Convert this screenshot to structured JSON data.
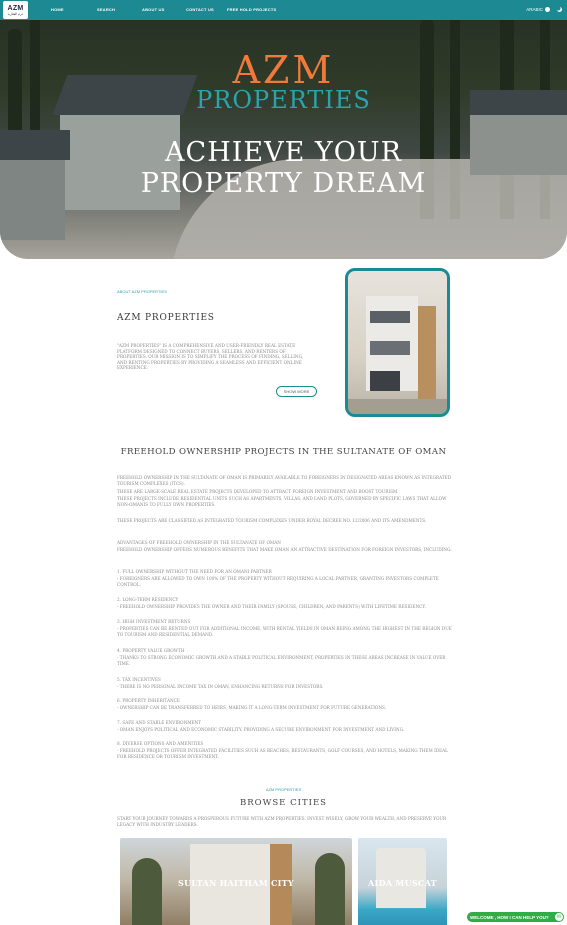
{
  "nav": {
    "logo_main": "AZM",
    "logo_sub": "عزم العقارية",
    "items": [
      "HOME",
      "SEARCH",
      "ABOUT US",
      "CONTACT US",
      "FREE HOLD PROJECTS"
    ],
    "language": "ARABIC",
    "icons": [
      "theme-dot-icon",
      "dark-mode-icon"
    ]
  },
  "hero": {
    "brand_line1": "AZM",
    "brand_line2": "PROPERTIES",
    "title_line1": "ACHIEVE YOUR",
    "title_line2": "PROPERTY DREAM"
  },
  "about": {
    "label": "ABOUT AZM PROPERTIES",
    "heading": "AZM  PROPERTIES",
    "text": "\"AZM PROPERTIES\" IS A COMPREHENSIVE AND USER-FRIENDLY REAL ESTATE PLATFORM DESIGNED TO CONNECT BUYERS, SELLERS, AND RENTERS OF PROPERTIES. OUR MISSION IS TO SIMPLIFY THE PROCESS OF FINDING, SELLING, AND RENTING PROPERTIES BY PROVIDING A SEAMLESS AND EFFICIENT ONLINE EXPERIENCE.",
    "button": "SHOW MORE"
  },
  "freehold": {
    "title": "FREEHOLD OWNERSHIP PROJECTS IN THE SULTANATE OF OMAN",
    "lines": [
      "FREEHOLD OWNERSHIP IN THE SULTANATE OF OMAN IS PRIMARILY AVAILABLE TO FOREIGNERS IN DESIGNATED AREAS KNOWN AS INTEGRATED TOURISM COMPLEXES (ITCS).",
      "THESE ARE LARGE-SCALE REAL ESTATE PROJECTS DEVELOPED TO ATTRACT FOREIGN INVESTMENT AND BOOST TOURISM.",
      "THESE PROJECTS INCLUDE RESIDENTIAL UNITS SUCH AS APARTMENTS, VILLAS, AND LAND PLOTS, GOVERNED BY SPECIFIC LAWS THAT ALLOW NON-OMANIS TO FULLY OWN PROPERTIES.",
      "THESE PROJECTS ARE CLASSIFIED AS INTEGRATED TOURISM COMPLEXES UNDER ROYAL DECREE NO. 12/2006 AND ITS AMENDMENTS.",
      "ADVANTAGES OF FREEHOLD OWNERSHIP IN THE SULTANATE OF OMAN",
      "FREEHOLD OWNERSHIP OFFERS NUMEROUS BENEFITS THAT MAKE OMAN AN ATTRACTIVE DESTINATION FOR FOREIGN INVESTORS, INCLUDING:",
      "1. FULL OWNERSHIP WITHOUT THE NEED FOR AN OMANI PARTNER",
      "- FOREIGNERS ARE ALLOWED TO OWN 100% OF THE PROPERTY WITHOUT REQUIRING A LOCAL PARTNER, GRANTING INVESTORS COMPLETE CONTROL.",
      "2. LONG-TERM RESIDENCY",
      "- FREEHOLD OWNERSHIP PROVIDES THE OWNER AND THEIR FAMILY (SPOUSE, CHILDREN, AND PARENTS) WITH LIFETIME RESIDENCY.",
      "3. HIGH INVESTMENT RETURNS",
      "- PROPERTIES CAN BE RENTED OUT FOR ADDITIONAL INCOME, WITH RENTAL YIELDS IN OMAN BEING AMONG THE HIGHEST IN THE REGION DUE TO TOURISM AND RESIDENTIAL DEMAND.",
      "4. PROPERTY VALUE GROWTH",
      "- THANKS TO STRONG ECONOMIC GROWTH AND A STABLE POLITICAL ENVIRONMENT, PROPERTIES IN THESE AREAS INCREASE IN VALUE OVER TIME.",
      "5. TAX INCENTIVES",
      "- THERE IS NO PERSONAL INCOME TAX IN OMAN, ENHANCING RETURNS FOR INVESTORS.",
      "6. PROPERTY INHERITANCE",
      "- OWNERSHIP CAN BE TRANSFERRED TO HEIRS, MAKING IT A LONG-TERM INVESTMENT FOR FUTURE GENERATIONS.",
      "7. SAFE AND STABLE ENVIRONMENT",
      "- OMAN ENJOYS POLITICAL AND ECONOMIC STABILITY, PROVIDING A SECURE ENVIRONMENT FOR INVESTMENT AND LIVING.",
      "8. DIVERSE OPTIONS AND AMENITIES",
      "- FREEHOLD PROJECTS OFFER INTEGRATED FACILITIES SUCH AS BEACHES, RESTAURANTS, GOLF COURSES, AND HOTELS, MAKING THEM IDEAL FOR RESIDENCE OR TOURISM INVESTMENT."
    ]
  },
  "cities": {
    "label": "AZM PROPERTIES",
    "title": "BROWSE CITIES",
    "description": "START YOUR JOURNEY TOWARDS A PROSPEROUS FUTURE WITH AZM PROPERTIES. INVEST WISELY, GROW YOUR WEALTH, AND PRESERVE YOUR LEGACY WITH INDUSTRY LEADERS.",
    "cards": [
      "SULTAN HAITHAM CITY",
      "AIDA MUSCAT"
    ]
  },
  "chat": {
    "label": "WELCOME , HOW I CAN HELP YOU?",
    "icon": "chat-icon"
  }
}
